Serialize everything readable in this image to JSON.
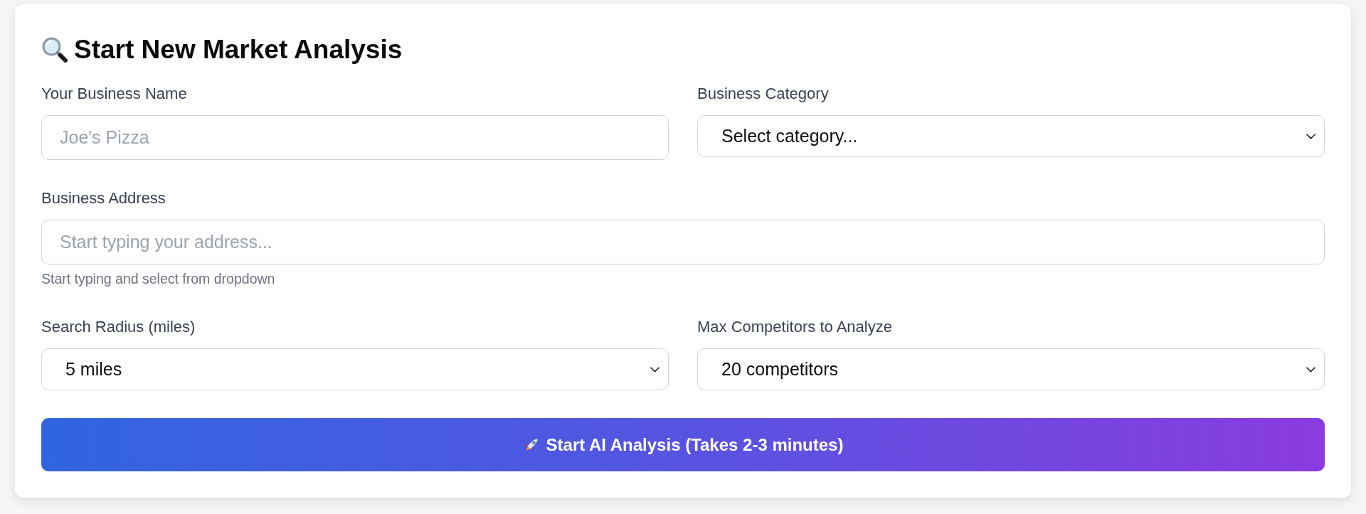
{
  "title": "Start New Market Analysis",
  "rows": [
    {
      "fields": [
        {
          "kind": "text",
          "label": "Your Business Name",
          "placeholder": "Joe's Pizza"
        },
        {
          "kind": "select",
          "label": "Business Category",
          "value": "Select category..."
        }
      ]
    },
    {
      "fields": [
        {
          "kind": "text",
          "label": "Business Address",
          "placeholder": "Start typing your address...",
          "hint": "Start typing and select from dropdown"
        }
      ]
    },
    {
      "fields": [
        {
          "kind": "select",
          "label": "Search Radius (miles)",
          "value": "5 miles"
        },
        {
          "kind": "select",
          "label": "Max Competitors to Analyze",
          "value": "20 competitors"
        }
      ]
    }
  ],
  "submit_button": {
    "label": "Start AI Analysis (Takes 2-3 minutes)"
  }
}
